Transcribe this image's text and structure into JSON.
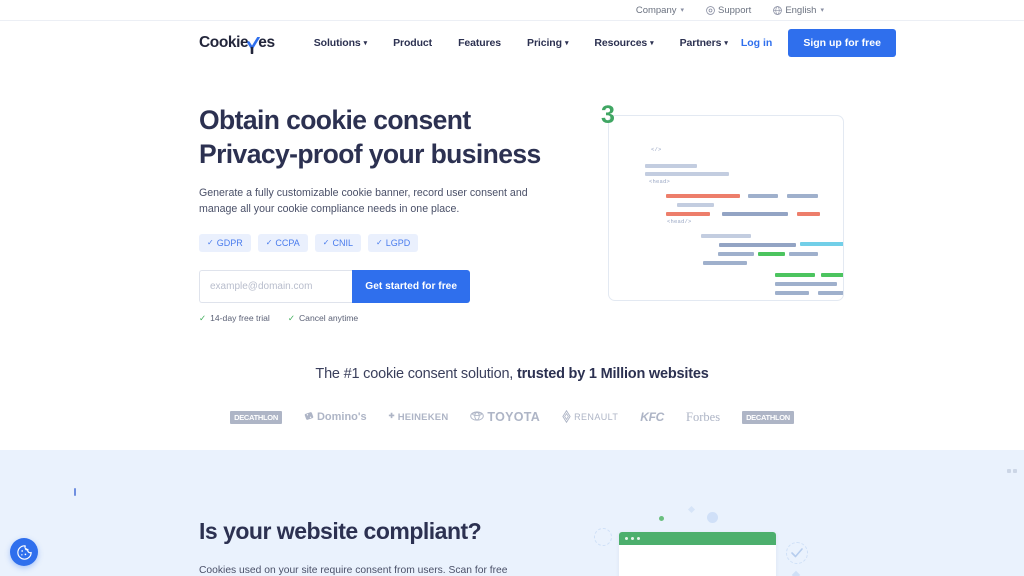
{
  "utility_bar": {
    "items": [
      {
        "label": "Company",
        "icon": "chevron-down-icon",
        "has_caret": true
      },
      {
        "label": "Support",
        "icon": "support-icon",
        "has_caret": false
      },
      {
        "label": "English",
        "icon": "globe-icon",
        "has_caret": true
      }
    ]
  },
  "nav": {
    "logo_part1": "Cookie",
    "logo_check": "Y",
    "logo_part2": "es",
    "links": [
      {
        "label": "Solutions",
        "has_caret": true
      },
      {
        "label": "Product",
        "has_caret": false
      },
      {
        "label": "Features",
        "has_caret": false
      },
      {
        "label": "Pricing",
        "has_caret": true
      },
      {
        "label": "Resources",
        "has_caret": true
      },
      {
        "label": "Partners",
        "has_caret": true
      }
    ],
    "login_label": "Log in",
    "signup_label": "Sign up for free",
    "accent_color": "#2f6fed"
  },
  "hero": {
    "title_line1": "Obtain cookie consent",
    "title_line2": "Privacy-proof your business",
    "subtitle": "Generate a fully customizable cookie banner, record user consent and manage all your cookie compliance needs in one place.",
    "badges": [
      "GDPR",
      "CCPA",
      "CNIL",
      "LGPD"
    ],
    "badge_tick": "✓",
    "email_placeholder": "example@domain.com",
    "email_value": "",
    "cta_label": "Get started for free",
    "trial_items": [
      "14-day free trial",
      "Cancel anytime"
    ],
    "trial_tick": "✓",
    "illustration_number": "3",
    "code_tags": [
      "</>",
      "<head>",
      "<head/>"
    ]
  },
  "social_proof": {
    "text_normal": "The #1 cookie consent solution, ",
    "text_bold": "trusted by 1 Million websites",
    "logos": [
      "DECATHLON",
      "Domino's",
      "HEINEKEN",
      "TOYOTA",
      "RENAULT",
      "KFC",
      "Forbes",
      "DECATHLON"
    ]
  },
  "lower_section": {
    "title": "Is your website compliant?",
    "subtitle": "Cookies used on your site require consent from users. Scan for free",
    "background_color": "#eaf2fd",
    "browser_accent_color": "#4caf6d"
  },
  "consent_widget": {
    "name": "cookie-settings-widget",
    "color": "#2f6fed"
  }
}
